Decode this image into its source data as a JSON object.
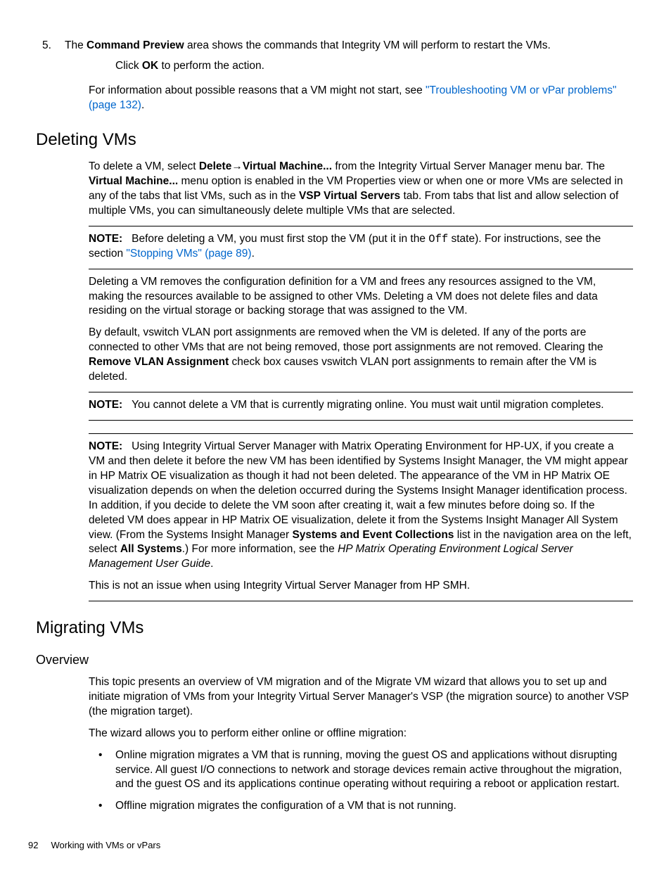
{
  "step5": {
    "num": "5.",
    "text_a": "The ",
    "bold_a": "Command Preview",
    "text_b": " area shows the commands that Integrity VM will perform to restart the VMs.",
    "text_c": "Click ",
    "bold_b": "OK",
    "text_d": " to perform the action."
  },
  "intro_para": {
    "text_a": "For information about possible reasons that a VM might not start, see ",
    "link_a": "\"Troubleshooting VM or vPar problems\" (page 132)",
    "text_b": "."
  },
  "deleting": {
    "heading": "Deleting VMs",
    "p1_a": "To delete a VM, select ",
    "p1_b1": "Delete",
    "p1_arrow": "→",
    "p1_b2": "Virtual Machine...",
    "p1_c": " from the Integrity Virtual Server Manager menu bar. The ",
    "p1_b3": "Virtual Machine...",
    "p1_d": " menu option is enabled in the VM Properties view or when one or more VMs are selected in any of the tabs that list VMs, such as in the ",
    "p1_b4": "VSP Virtual Servers",
    "p1_e": " tab. From tabs that list and allow selection of multiple VMs, you can simultaneously delete multiple VMs that are selected.",
    "note1_label": "NOTE:",
    "note1_a": "Before deleting a VM, you must first stop the VM (put it in the ",
    "note1_mono": "Off",
    "note1_b": " state). For instructions, see the section ",
    "note1_link": "\"Stopping VMs\" (page 89)",
    "note1_c": ".",
    "p2": "Deleting a VM removes the configuration definition for a VM and frees any resources assigned to the VM, making the resources available to be assigned to other VMs. Deleting a VM does not delete files and data residing on the virtual storage or backing storage that was assigned to the VM.",
    "p3_a": "By default, vswitch VLAN port assignments are removed when the VM is deleted. If any of the ports are connected to other VMs that are not being removed, those port assignments are not removed. Clearing the ",
    "p3_b": "Remove VLAN Assignment",
    "p3_c": " check box causes vswitch VLAN port assignments to remain after the VM is deleted.",
    "note2_label": "NOTE:",
    "note2_text": "You cannot delete a VM that is currently migrating online. You must wait until migration completes.",
    "note3_label": "NOTE:",
    "note3_a": "Using Integrity Virtual Server Manager with Matrix Operating Environment for HP-UX, if you create a VM and then delete it before the new VM has been identified by Systems Insight Manager, the VM might appear in HP Matrix OE visualization as though it had not been deleted. The appearance of the VM in HP Matrix OE visualization depends on when the deletion occurred during the Systems Insight Manager identification process. In addition, if you decide to delete the VM soon after creating it, wait a few minutes before doing so. If the deleted VM does appear in HP Matrix OE visualization, delete it from the Systems Insight Manager All System view. (From the Systems Insight Manager ",
    "note3_b1": "Systems and Event Collections",
    "note3_b": " list in the navigation area on the left, select ",
    "note3_b2": "All Systems",
    "note3_c": ".) For more information, see the ",
    "note3_em": "HP Matrix Operating Environment Logical Server Management User Guide",
    "note3_d": ".",
    "p4": "This is not an issue when using Integrity Virtual Server Manager from HP SMH."
  },
  "migrating": {
    "heading": "Migrating VMs",
    "sub": "Overview",
    "p1": "This topic presents an overview of VM migration and of the Migrate VM wizard that allows you to set up and initiate migration of VMs from your Integrity Virtual Server Manager's VSP (the migration source) to another VSP (the migration target).",
    "p2": "The wizard allows you to perform either online or offline migration:",
    "b1": "Online migration migrates a VM that is running, moving the guest OS and applications without disrupting service. All guest I/O connections to network and storage devices remain active throughout the migration, and the guest OS and its applications continue operating without requiring a reboot or application restart.",
    "b2": "Offline migration migrates the configuration of a VM that is not running."
  },
  "footer": {
    "page": "92",
    "title": "Working with VMs or vPars"
  }
}
